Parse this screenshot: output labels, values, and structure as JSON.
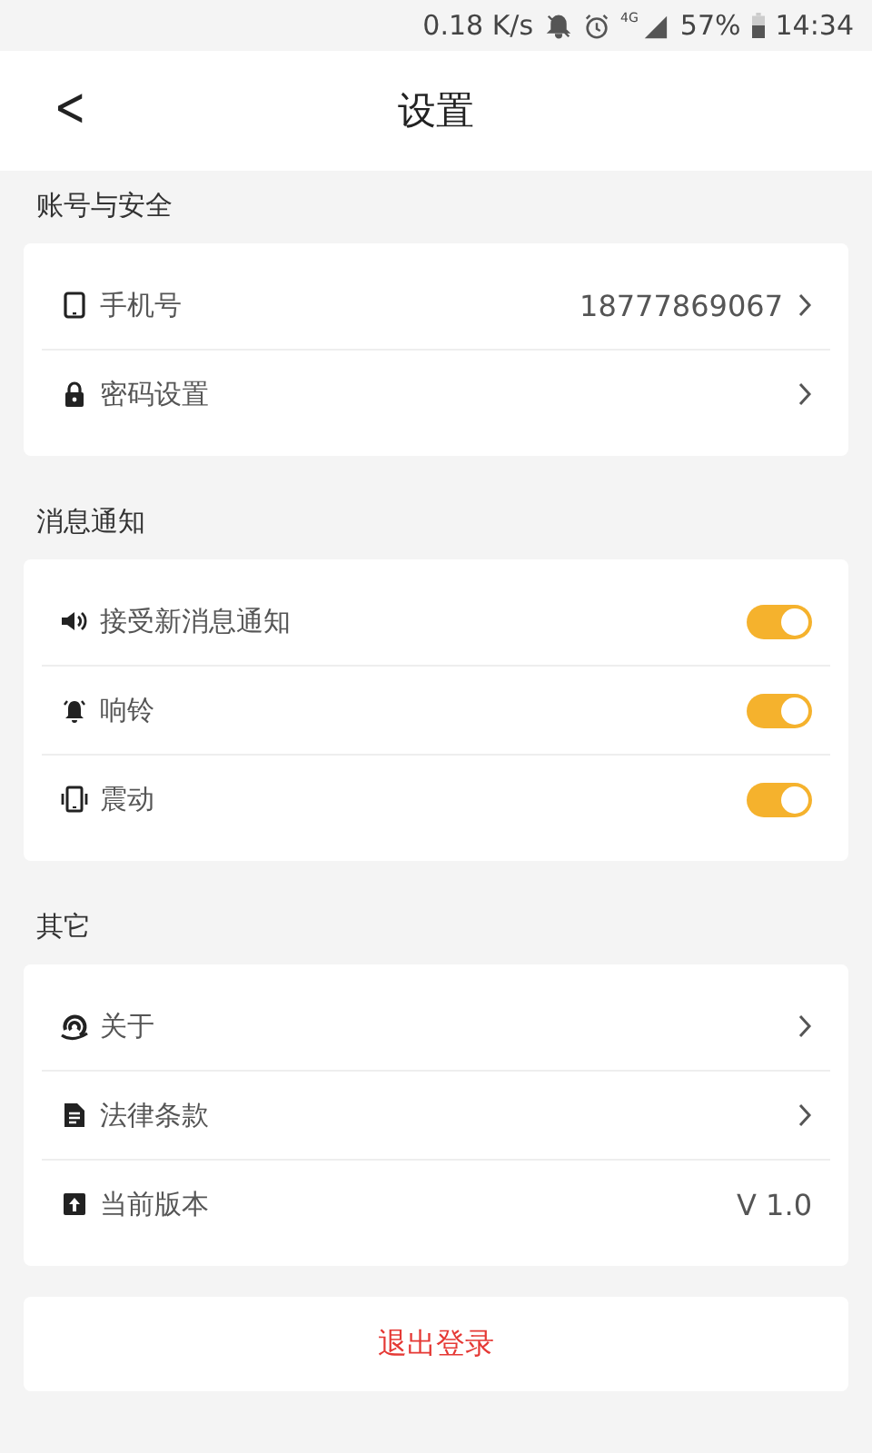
{
  "status_bar": {
    "speed": "0.18 K/s",
    "network": "4G",
    "battery": "57%",
    "time": "14:34"
  },
  "header": {
    "back": "<",
    "title": "设置"
  },
  "sections": [
    {
      "title": "账号与安全",
      "rows": [
        {
          "kind": "link",
          "label": "手机号",
          "value": "18777869067"
        },
        {
          "kind": "link",
          "label": "密码设置"
        }
      ]
    },
    {
      "title": "消息通知",
      "rows": [
        {
          "kind": "toggle",
          "label": "接受新消息通知",
          "on": true
        },
        {
          "kind": "toggle",
          "label": "响铃",
          "on": true
        },
        {
          "kind": "toggle",
          "label": "震动",
          "on": true
        }
      ]
    },
    {
      "title": "其它",
      "rows": [
        {
          "kind": "link",
          "label": "关于"
        },
        {
          "kind": "link",
          "label": "法律条款"
        },
        {
          "kind": "info",
          "label": "当前版本",
          "value": "V 1.0"
        }
      ]
    }
  ],
  "logout": "退出登录"
}
